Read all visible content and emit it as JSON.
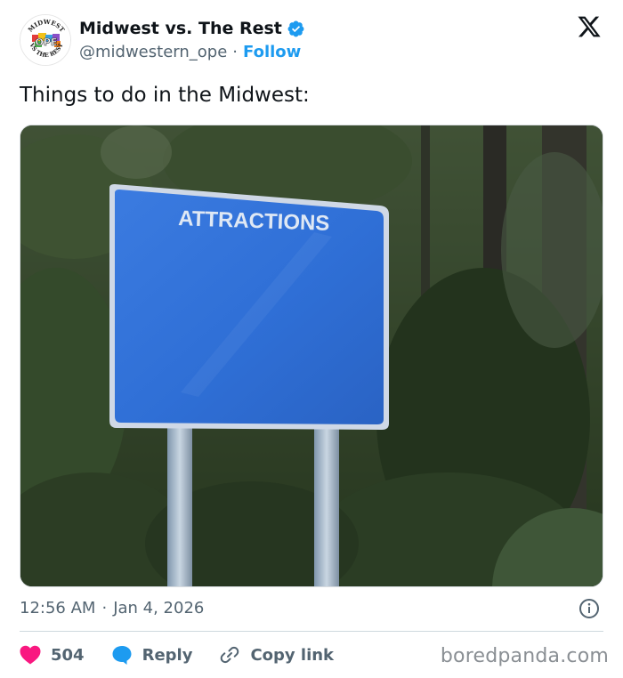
{
  "author": {
    "display_name": "Midwest vs. The Rest",
    "handle": "@midwestern_ope",
    "separator": "·",
    "follow_label": "Follow",
    "verified": true,
    "avatar_text": {
      "top": "MIDWEST",
      "center": "OPE",
      "bottom": "VS THE REST"
    }
  },
  "tweet": {
    "text": "Things to do in the Midwest:",
    "image": {
      "sign_text": "ATTRACTIONS",
      "sign_color": "#2f6fd6"
    }
  },
  "meta": {
    "time": "12:56 AM",
    "separator": "·",
    "date": "Jan 4, 2026"
  },
  "actions": {
    "likes_count": "504",
    "reply_label": "Reply",
    "copy_link_label": "Copy link"
  },
  "watermark": "boredpanda.com",
  "colors": {
    "accent": "#1d9bf0",
    "like": "#f91880",
    "secondary_text": "#536471"
  },
  "icons": [
    "verified-badge-icon",
    "x-logo-icon",
    "info-icon",
    "heart-icon",
    "reply-bubble-icon",
    "link-icon"
  ]
}
